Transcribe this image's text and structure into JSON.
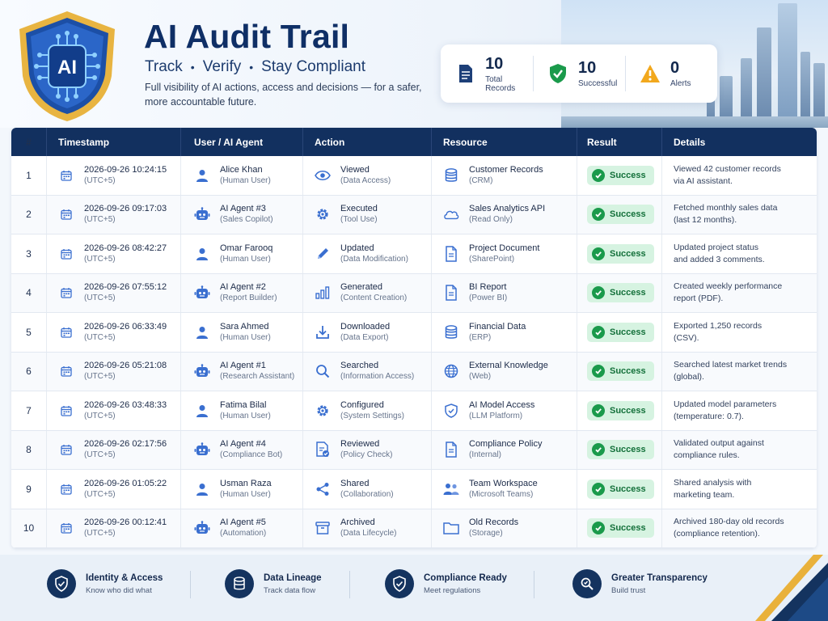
{
  "header": {
    "title": "AI Audit Trail",
    "tagline": [
      "Track",
      "Verify",
      "Stay Compliant"
    ],
    "tagline_sep": "•",
    "description": "Full visibility of AI actions, access and decisions — for a safer, more accountable future.",
    "logo_text": "AI"
  },
  "stats": [
    {
      "value": "10",
      "label": "Total Records",
      "icon": "document-icon",
      "color": "#1d3f78"
    },
    {
      "value": "10",
      "label": "Successful",
      "icon": "shield-check-icon",
      "color": "#1a9a4b"
    },
    {
      "value": "0",
      "label": "Alerts",
      "icon": "warning-icon",
      "color": "#f2a81d"
    }
  ],
  "table": {
    "headers": [
      "#",
      "Timestamp",
      "User / AI Agent",
      "Action",
      "Resource",
      "Result",
      "Details"
    ],
    "rows": [
      {
        "n": "1",
        "ts": "2026-09-26 10:24:15",
        "tz": "(UTC+5)",
        "user": "Alice Khan",
        "user_type": "(Human User)",
        "user_icon": "person-icon",
        "action": "Viewed",
        "action_sub": "(Data Access)",
        "action_icon": "eye-icon",
        "res": "Customer Records",
        "res_sub": "(CRM)",
        "res_icon": "database-icon",
        "result": "Success",
        "details": [
          "Viewed 42 customer records",
          "via AI assistant."
        ]
      },
      {
        "n": "2",
        "ts": "2026-09-26 09:17:03",
        "tz": "(UTC+5)",
        "user": "AI Agent #3",
        "user_type": "(Sales Copilot)",
        "user_icon": "robot-icon",
        "action": "Executed",
        "action_sub": "(Tool Use)",
        "action_icon": "gear-icon",
        "res": "Sales Analytics API",
        "res_sub": "(Read Only)",
        "res_icon": "cloud-icon",
        "result": "Success",
        "details": [
          "Fetched monthly sales data",
          "(last 12 months)."
        ]
      },
      {
        "n": "3",
        "ts": "2026-09-26 08:42:27",
        "tz": "(UTC+5)",
        "user": "Omar Farooq",
        "user_type": "(Human User)",
        "user_icon": "person-icon",
        "action": "Updated",
        "action_sub": "(Data Modification)",
        "action_icon": "pencil-icon",
        "res": "Project Document",
        "res_sub": "(SharePoint)",
        "res_icon": "file-icon",
        "result": "Success",
        "details": [
          "Updated project status",
          "and added 3 comments."
        ]
      },
      {
        "n": "4",
        "ts": "2026-09-26 07:55:12",
        "tz": "(UTC+5)",
        "user": "AI Agent #2",
        "user_type": "(Report Builder)",
        "user_icon": "robot-icon",
        "action": "Generated",
        "action_sub": "(Content Creation)",
        "action_icon": "bar-chart-icon",
        "res": "BI Report",
        "res_sub": "(Power BI)",
        "res_icon": "file-icon",
        "result": "Success",
        "details": [
          "Created weekly performance",
          "report (PDF)."
        ]
      },
      {
        "n": "5",
        "ts": "2026-09-26 06:33:49",
        "tz": "(UTC+5)",
        "user": "Sara Ahmed",
        "user_type": "(Human User)",
        "user_icon": "person-icon",
        "action": "Downloaded",
        "action_sub": "(Data Export)",
        "action_icon": "download-icon",
        "res": "Financial Data",
        "res_sub": "(ERP)",
        "res_icon": "database-icon",
        "result": "Success",
        "details": [
          "Exported 1,250 records",
          "(CSV)."
        ]
      },
      {
        "n": "6",
        "ts": "2026-09-26 05:21:08",
        "tz": "(UTC+5)",
        "user": "AI Agent #1",
        "user_type": "(Research Assistant)",
        "user_icon": "robot-icon",
        "action": "Searched",
        "action_sub": "(Information Access)",
        "action_icon": "search-icon",
        "res": "External Knowledge",
        "res_sub": "(Web)",
        "res_icon": "globe-icon",
        "result": "Success",
        "details": [
          "Searched latest market trends",
          "(global)."
        ]
      },
      {
        "n": "7",
        "ts": "2026-09-26 03:48:33",
        "tz": "(UTC+5)",
        "user": "Fatima Bilal",
        "user_type": "(Human User)",
        "user_icon": "person-icon",
        "action": "Configured",
        "action_sub": "(System Settings)",
        "action_icon": "gear-icon",
        "res": "AI Model Access",
        "res_sub": "(LLM Platform)",
        "res_icon": "shield-icon",
        "result": "Success",
        "details": [
          "Updated model parameters",
          "(temperature: 0.7)."
        ]
      },
      {
        "n": "8",
        "ts": "2026-09-26 02:17:56",
        "tz": "(UTC+5)",
        "user": "AI Agent #4",
        "user_type": "(Compliance Bot)",
        "user_icon": "robot-icon",
        "action": "Reviewed",
        "action_sub": "(Policy Check)",
        "action_icon": "doc-check-icon",
        "res": "Compliance Policy",
        "res_sub": "(Internal)",
        "res_icon": "file-icon",
        "result": "Success",
        "details": [
          "Validated output against",
          "compliance rules."
        ]
      },
      {
        "n": "9",
        "ts": "2026-09-26 01:05:22",
        "tz": "(UTC+5)",
        "user": "Usman Raza",
        "user_type": "(Human User)",
        "user_icon": "person-icon",
        "action": "Shared",
        "action_sub": "(Collaboration)",
        "action_icon": "share-icon",
        "res": "Team Workspace",
        "res_sub": "(Microsoft Teams)",
        "res_icon": "team-icon",
        "result": "Success",
        "details": [
          "Shared analysis with",
          "marketing team."
        ]
      },
      {
        "n": "10",
        "ts": "2026-09-26 00:12:41",
        "tz": "(UTC+5)",
        "user": "AI Agent #5",
        "user_type": "(Automation)",
        "user_icon": "robot-icon",
        "action": "Archived",
        "action_sub": "(Data Lifecycle)",
        "action_icon": "archive-icon",
        "res": "Old Records",
        "res_sub": "(Storage)",
        "res_icon": "folder-icon",
        "result": "Success",
        "details": [
          "Archived 180-day old records",
          "(compliance retention)."
        ]
      }
    ]
  },
  "footer": [
    {
      "title": "Identity & Access",
      "sub": "Know who did what",
      "icon": "shield-check-icon"
    },
    {
      "title": "Data Lineage",
      "sub": "Track data flow",
      "icon": "database-icon"
    },
    {
      "title": "Compliance Ready",
      "sub": "Meet regulations",
      "icon": "shield-check-icon"
    },
    {
      "title": "Greater Transparency",
      "sub": "Build trust",
      "icon": "search-icon"
    }
  ],
  "colors": {
    "navy": "#12305f",
    "success_bg": "#d6f3e1",
    "success": "#1a9a4b",
    "icon_blue": "#3a6fd0",
    "gold": "#e9b13b"
  }
}
